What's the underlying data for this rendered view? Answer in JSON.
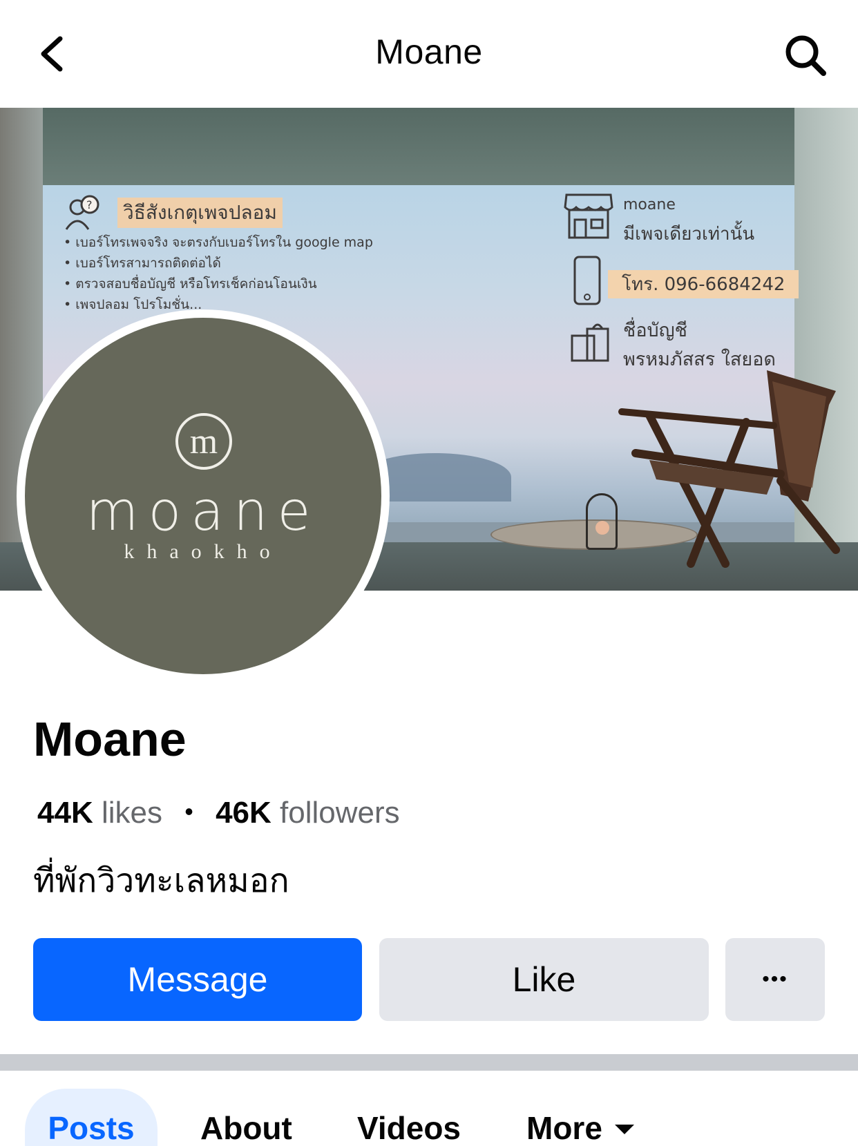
{
  "header": {
    "title": "Moane",
    "back_icon": "chevron-left-icon",
    "search_icon": "search-icon"
  },
  "cover": {
    "heading": "วิธีสังเกตุเพจปลอม",
    "bullets": [
      "• เบอร์โทรเพจจริง จะตรงกับเบอร์โทรใน google map",
      "• เบอร์โทรสามารถติดต่อได้",
      "• ตรวจสอบชื่อบัญชี หรือโทรเช็คก่อนโอนเงิน",
      "• เพจปลอม โปรโมชั่น..."
    ],
    "brand": "moane",
    "brand_note": "มีเพจเดียวเท่านั้น",
    "phone": "โทร. 096-6684242",
    "account_label": "ชื่อบัญชี",
    "account_name": "พรหมภัสสร ใสยอด"
  },
  "avatar": {
    "wordmark": "moane",
    "subtitle": "khaokho",
    "monogram": "m"
  },
  "page": {
    "name": "Moane",
    "likes_count": "44K",
    "likes_label": "likes",
    "separator": "•",
    "followers_count": "46K",
    "followers_label": "followers",
    "category": "ที่พักวิวทะเลหมอก"
  },
  "actions": {
    "message": "Message",
    "like": "Like",
    "more": "•••"
  },
  "tabs": [
    {
      "label": "Posts",
      "active": true
    },
    {
      "label": "About",
      "active": false
    },
    {
      "label": "Videos",
      "active": false
    },
    {
      "label": "More",
      "active": false
    }
  ],
  "colors": {
    "primary": "#0866ff",
    "secondary_button": "#e4e6eb",
    "avatar_bg": "#66685a",
    "active_tab_bg": "#e6f0ff"
  }
}
